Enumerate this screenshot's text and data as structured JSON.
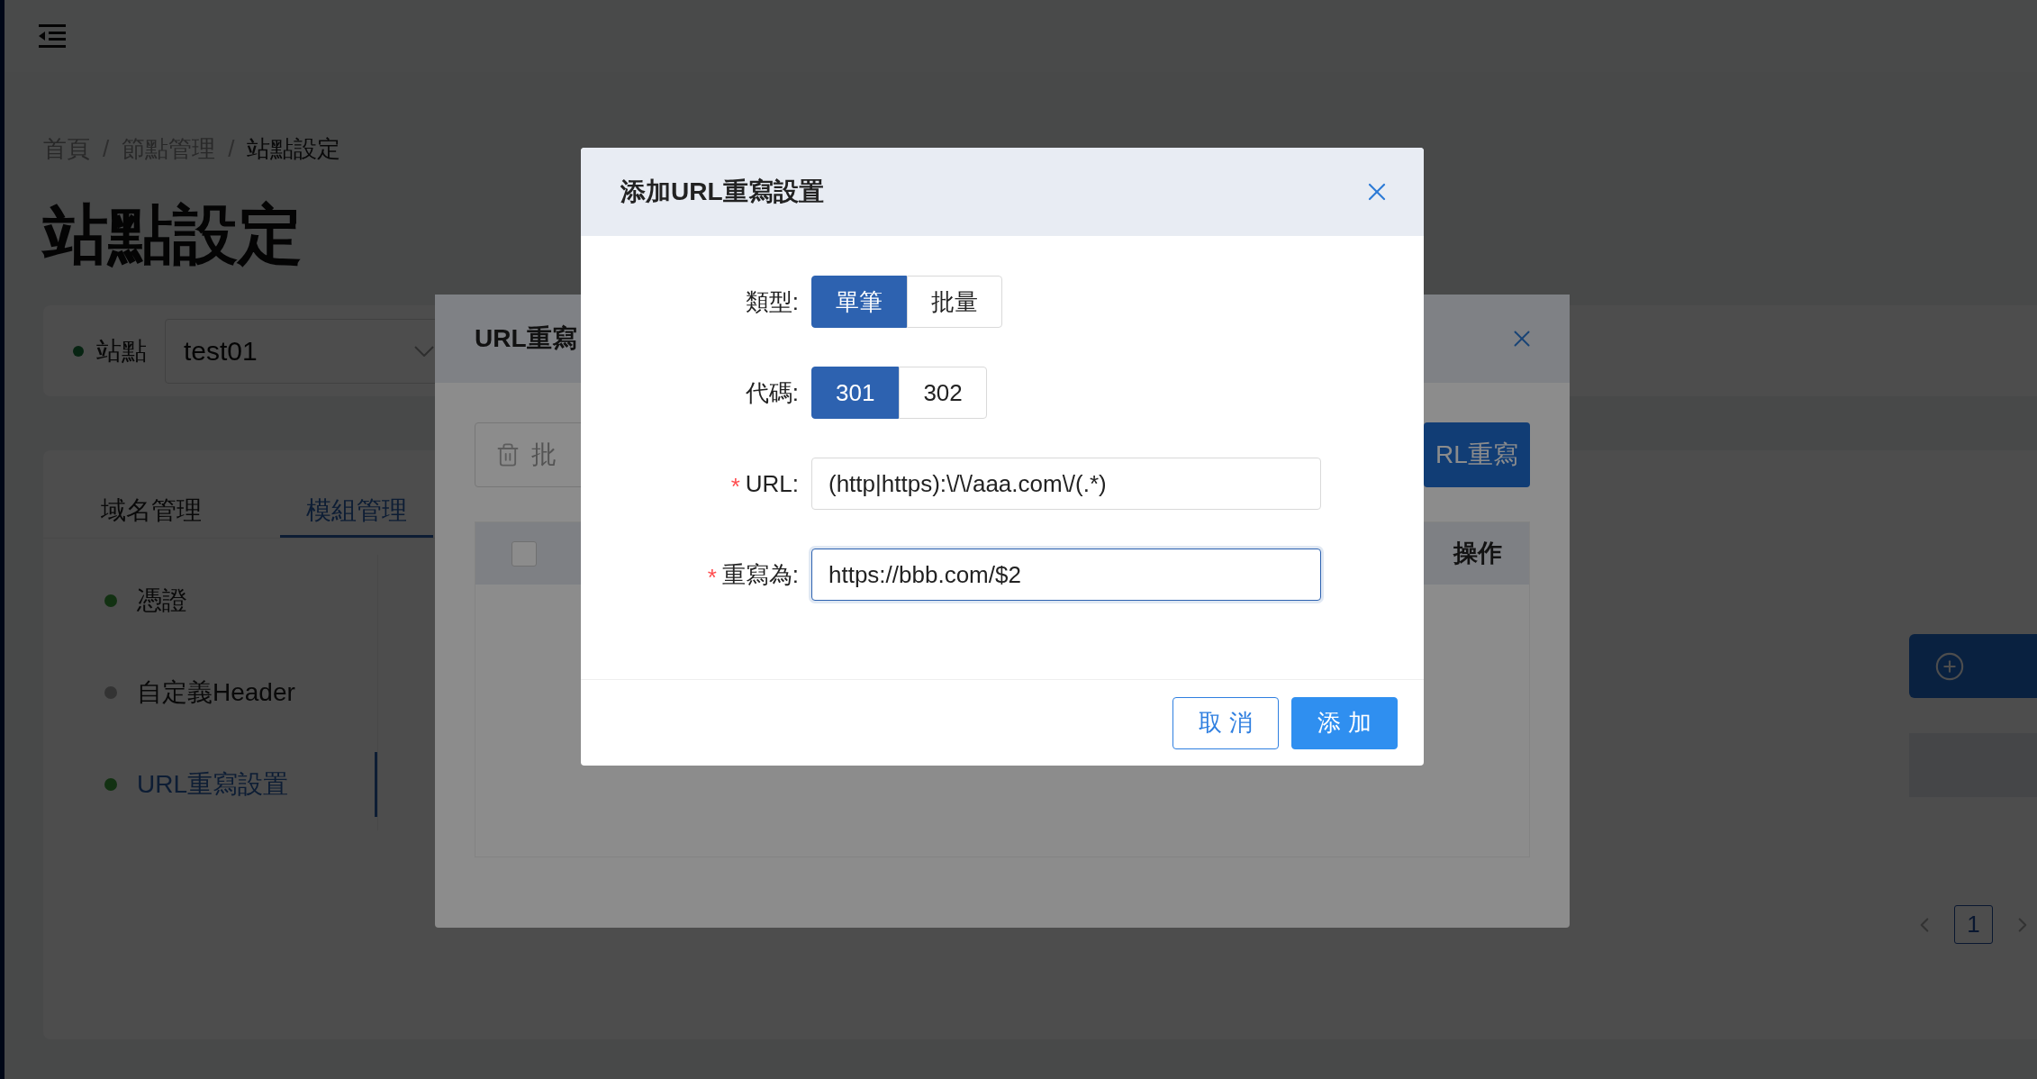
{
  "page": {
    "breadcrumb": [
      {
        "label": "首頁",
        "current": false
      },
      {
        "label": "節點管理",
        "current": false
      },
      {
        "label": "站點設定",
        "current": true
      }
    ],
    "breadcrumb_separator": "/",
    "title": "站點設定",
    "site_selector": {
      "label": "站點",
      "value": "test01"
    },
    "tabs": [
      {
        "label": "域名管理",
        "selected": false
      },
      {
        "label": "模組管理",
        "selected": true
      }
    ],
    "modules": [
      {
        "label": "憑證",
        "enabled": true,
        "selected": false
      },
      {
        "label": "自定義Header",
        "enabled": false,
        "selected": false
      },
      {
        "label": "URL重寫設置",
        "enabled": true,
        "selected": true
      }
    ],
    "pagination": {
      "pages": [
        {
          "label": "1",
          "selected": true
        }
      ]
    }
  },
  "url_rewrite_modal": {
    "title": "URL重寫",
    "batch_button": "批",
    "add_button": "RL重寫",
    "table": {
      "select_all_checked": false,
      "columns": [
        "操作"
      ]
    }
  },
  "dialog": {
    "title": "添加URL重寫設置",
    "required_mark": "*",
    "fields": [
      {
        "kind": "segmented",
        "label": "類型:",
        "required": false,
        "options": [
          {
            "label": "單筆",
            "selected": true
          },
          {
            "label": "批量",
            "selected": false
          }
        ]
      },
      {
        "kind": "segmented",
        "label": "代碼:",
        "required": false,
        "options": [
          {
            "label": "301",
            "selected": true
          },
          {
            "label": "302",
            "selected": false
          }
        ]
      },
      {
        "kind": "input",
        "label": "URL:",
        "required": true,
        "value": "(http|https):\\/\\/aaa.com\\/(.*)",
        "focused": false
      },
      {
        "kind": "input",
        "label": "重寫為:",
        "required": true,
        "value": "https://bbb.com/$2",
        "focused": true
      }
    ],
    "buttons": [
      {
        "label": "取 消",
        "kind": "secondary"
      },
      {
        "label": "添 加",
        "kind": "primary"
      }
    ]
  }
}
